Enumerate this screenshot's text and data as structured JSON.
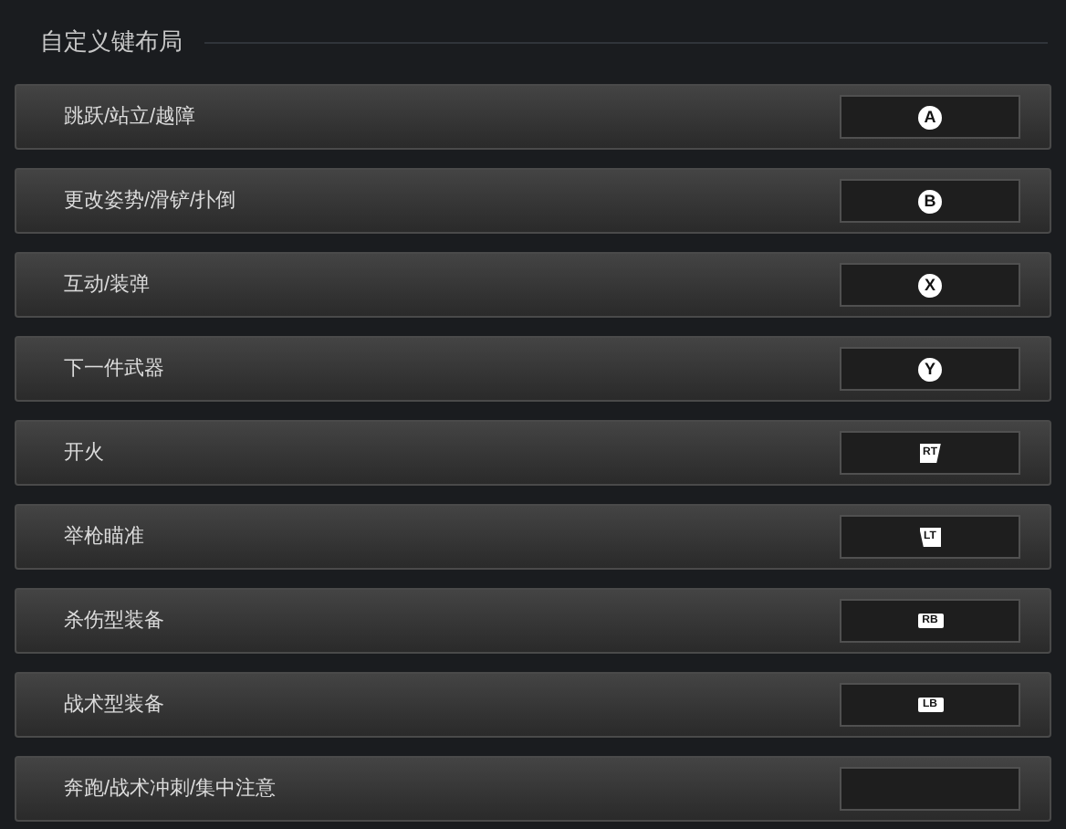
{
  "title": "自定义键布局",
  "bindings": [
    {
      "action": "跳跃/站立/越障",
      "key": {
        "kind": "face",
        "label": "A"
      }
    },
    {
      "action": "更改姿势/滑铲/扑倒",
      "key": {
        "kind": "face",
        "label": "B"
      }
    },
    {
      "action": "互动/装弹",
      "key": {
        "kind": "face",
        "label": "X"
      }
    },
    {
      "action": "下一件武器",
      "key": {
        "kind": "face",
        "label": "Y"
      }
    },
    {
      "action": "开火",
      "key": {
        "kind": "trigger_right",
        "label": "RT"
      }
    },
    {
      "action": "举枪瞄准",
      "key": {
        "kind": "trigger_left",
        "label": "LT"
      }
    },
    {
      "action": "杀伤型装备",
      "key": {
        "kind": "bumper",
        "label": "RB"
      }
    },
    {
      "action": "战术型装备",
      "key": {
        "kind": "bumper",
        "label": "LB"
      }
    },
    {
      "action": "奔跑/战术冲刺/集中注意"
    }
  ]
}
